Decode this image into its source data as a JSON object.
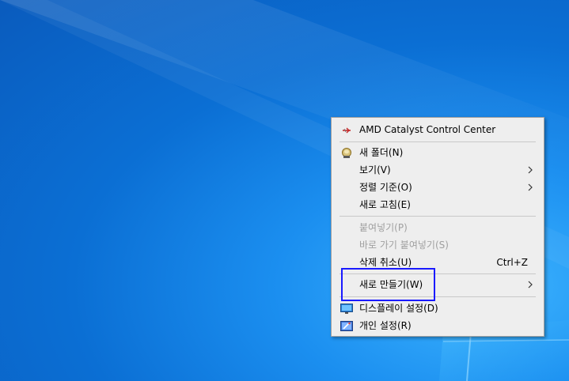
{
  "colors": {
    "desktop_accent": "#0b6fd4",
    "menu_background": "#eeeeee",
    "highlight_border": "#1a1aff"
  },
  "context_menu": {
    "items": [
      {
        "label": "AMD Catalyst Control Center",
        "icon": "amd-catalyst-icon"
      },
      {
        "label": "새 폴더(N)",
        "icon": "new-folder-icon"
      },
      {
        "label": "보기(V)",
        "has_submenu": true
      },
      {
        "label": "정렬 기준(O)",
        "has_submenu": true
      },
      {
        "label": "새로 고침(E)"
      },
      {
        "label": "붙여넣기(P)",
        "disabled": true
      },
      {
        "label": "바로 가기 붙여넣기(S)",
        "disabled": true
      },
      {
        "label": "삭제 취소(U)",
        "shortcut": "Ctrl+Z"
      },
      {
        "label": "새로 만들기(W)",
        "has_submenu": true
      },
      {
        "label": "디스플레이 설정(D)",
        "icon": "display-settings-icon"
      },
      {
        "label": "개인 설정(R)",
        "icon": "personalize-icon"
      }
    ]
  }
}
